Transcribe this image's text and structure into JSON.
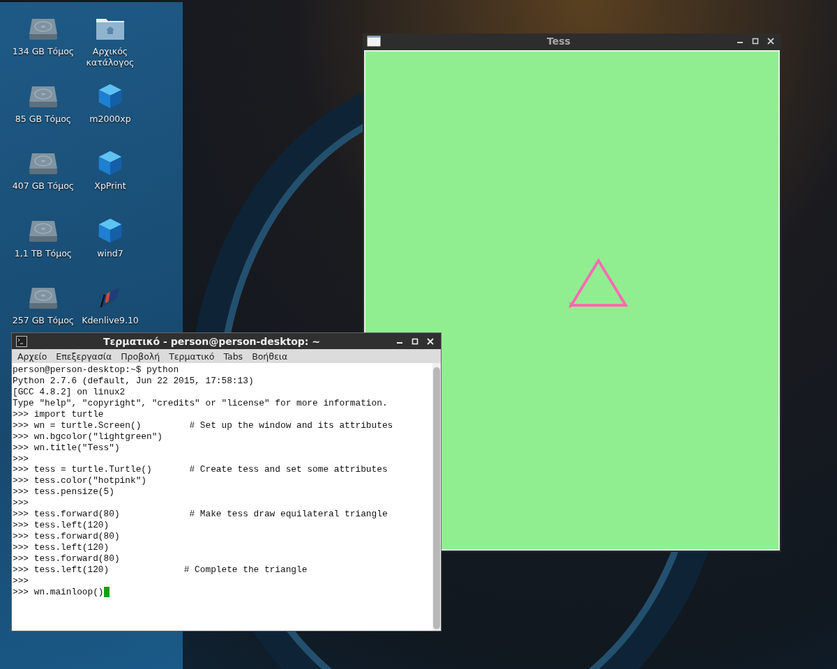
{
  "desktop_icons": [
    {
      "label": "134 GB Τόμος",
      "kind": "drive"
    },
    {
      "label": "Αρχικός κατάλογος",
      "kind": "folder"
    },
    {
      "label": "85 GB Τόμος",
      "kind": "drive"
    },
    {
      "label": "m2000xp",
      "kind": "vbox"
    },
    {
      "label": "407 GB Τόμος",
      "kind": "drive"
    },
    {
      "label": "XpPrint",
      "kind": "vbox"
    },
    {
      "label": "1,1 TB Τόμος",
      "kind": "drive"
    },
    {
      "label": "wind7",
      "kind": "vbox"
    },
    {
      "label": "257 GB Τόμος",
      "kind": "drive"
    },
    {
      "label": "Kdenlive9.10",
      "kind": "film"
    }
  ],
  "turtle_window": {
    "title": "Tess"
  },
  "terminal": {
    "title": "Τερματικό - person@person-desktop: ~",
    "menu": [
      "Αρχείο",
      "Επεξεργασία",
      "Προβολή",
      "Τερματικό",
      "Tabs",
      "Βοήθεια"
    ],
    "lines": [
      "person@person-desktop:~$ python",
      "Python 2.7.6 (default, Jun 22 2015, 17:58:13)",
      "[GCC 4.8.2] on linux2",
      "Type \"help\", \"copyright\", \"credits\" or \"license\" for more information.",
      ">>> import turtle",
      ">>> wn = turtle.Screen()         # Set up the window and its attributes",
      ">>> wn.bgcolor(\"lightgreen\")",
      ">>> wn.title(\"Tess\")",
      ">>>",
      ">>> tess = turtle.Turtle()       # Create tess and set some attributes",
      ">>> tess.color(\"hotpink\")",
      ">>> tess.pensize(5)",
      ">>>",
      ">>> tess.forward(80)             # Make tess draw equilateral triangle",
      ">>> tess.left(120)",
      ">>> tess.forward(80)",
      ">>> tess.left(120)",
      ">>> tess.forward(80)",
      ">>> tess.left(120)              # Complete the triangle",
      ">>>",
      ">>> wn.mainloop()"
    ]
  }
}
